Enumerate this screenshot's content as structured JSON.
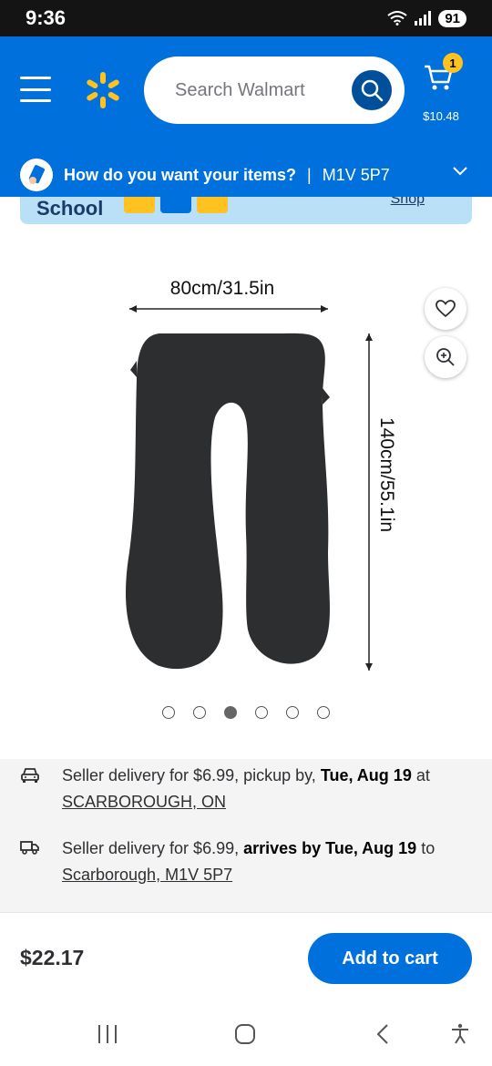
{
  "status": {
    "time": "9:36",
    "battery": "91"
  },
  "header": {
    "search_placeholder": "Search Walmart",
    "cart_count": "1",
    "cart_total": "$10.48"
  },
  "delivery": {
    "question": "How do you want your items?",
    "separator": "|",
    "postal": "M1V 5P7"
  },
  "promo": {
    "text": "School",
    "link": "Shop"
  },
  "product_image": {
    "width_label": "80cm/31.5in",
    "height_label": "140cm/55.1in"
  },
  "carousel": {
    "count": 6,
    "active_index": 2
  },
  "fulfillment": {
    "pickup": {
      "prefix": "Seller delivery for $6.99, pickup by, ",
      "date": "Tue, Aug 19",
      "suffix": " at",
      "location": "SCARBOROUGH, ON"
    },
    "shipping": {
      "prefix": "Seller delivery for $6.99, ",
      "date": "arrives by Tue, Aug 19",
      "suffix": " to",
      "location": "Scarborough, M1V 5P7"
    }
  },
  "purchase": {
    "price": "$22.17",
    "add_to_cart": "Add to cart"
  },
  "colors": {
    "brand_blue": "#0071dc",
    "spark_yellow": "#ffc220",
    "dark_blue": "#004f9a"
  }
}
